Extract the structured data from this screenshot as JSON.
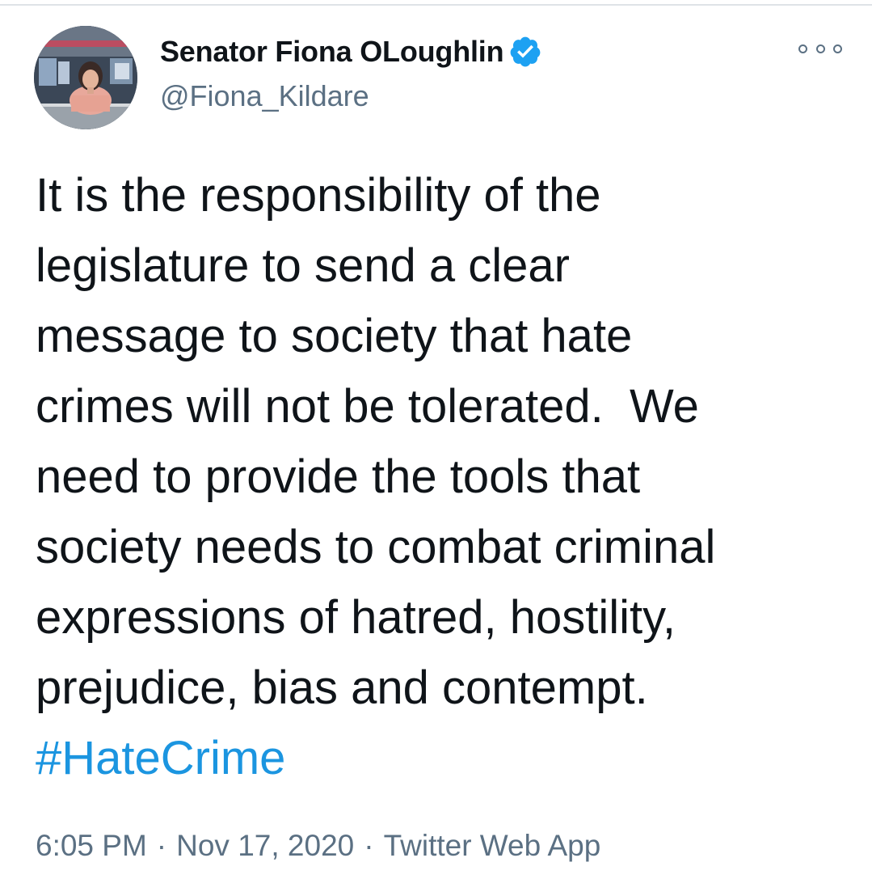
{
  "author": {
    "name": "Senator Fiona OLoughlin",
    "handle": "@Fiona_Kildare",
    "verified": true
  },
  "tweet": {
    "lines": [
      "It is the responsibility of the",
      "legislature to send a clear",
      "message to society that hate",
      "crimes will not be tolerated.  We",
      "need to provide the tools that",
      "society needs to combat criminal",
      "expressions of hatred, hostility,",
      "prejudice, bias and contempt."
    ],
    "hashtag": "#HateCrime"
  },
  "meta": {
    "time": "6:05 PM",
    "separator": "·",
    "date": "Nov 17, 2020",
    "source": "Twitter Web App"
  },
  "icons": {
    "verified": "verified-badge-icon",
    "more": "more-options-icon"
  },
  "colors": {
    "text": "#0f1419",
    "secondary_text": "#5b7083",
    "link": "#1b95e0",
    "verified_badge": "#1da1f2",
    "divider": "#dfe3e7"
  }
}
